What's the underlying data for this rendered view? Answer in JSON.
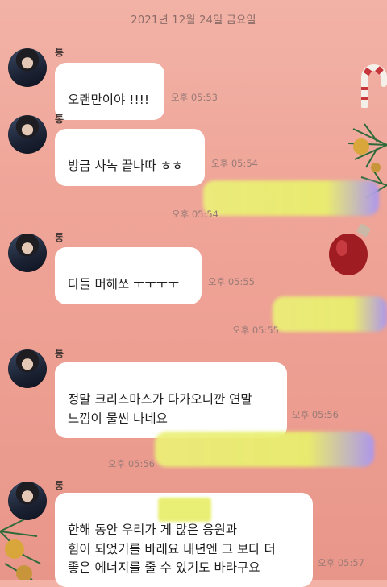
{
  "date_header": "2021년 12월 24일 금요일",
  "sender_name": "통",
  "messages": [
    {
      "text": "오랜만이야 !!!!",
      "time": "오후 05:53"
    },
    {
      "text": "방금 사녹 끝나따 ㅎㅎ",
      "time": "오후 05:54"
    },
    {
      "text": "다들 머해쏘 ㅜㅜㅜㅜ",
      "time": "오후 05:55"
    },
    {
      "text": "정말 크리스마스가 다가오니깐 연말\n느낌이 물씬 나네요",
      "time": "오후 05:56"
    },
    {
      "text": "한해 동안 우리가        게 많은 응원과\n힘이 되었기를 바래요 내년엔 그 보다 더\n좋은 에너지를 줄 수 있기도 바라구요",
      "time": "오후 05:57"
    }
  ],
  "sent_times": [
    "오후 05:54",
    "오후 05:55",
    "오후 05:56"
  ],
  "colors": {
    "background": "#efa598",
    "bubble": "#ffffff",
    "redaction": "#e8ee6e"
  }
}
